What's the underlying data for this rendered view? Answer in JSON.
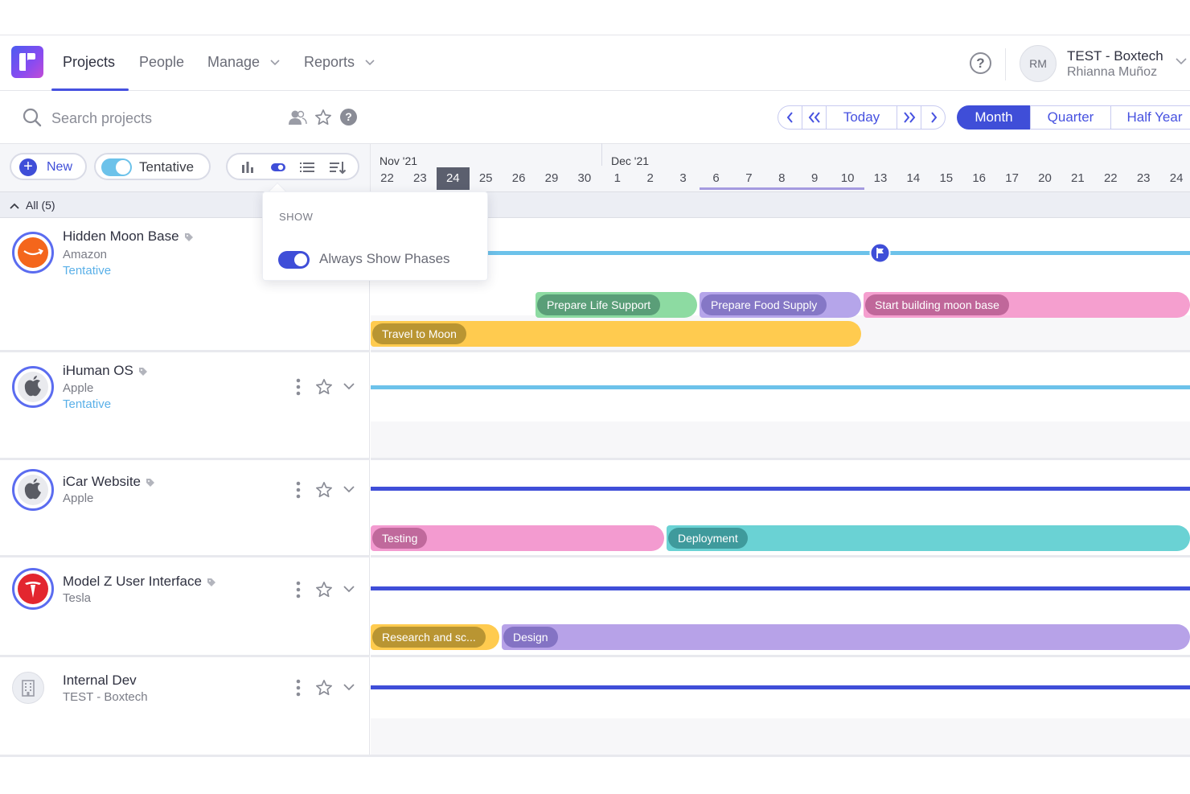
{
  "nav": {
    "items": [
      {
        "label": "Projects",
        "active": true
      },
      {
        "label": "People"
      },
      {
        "label": "Manage"
      },
      {
        "label": "Reports"
      }
    ],
    "help_label": "?",
    "account": {
      "avatar_initials": "RM",
      "name": "TEST - Boxtech",
      "user": "Rhianna Muñoz"
    }
  },
  "toolbar": {
    "search_placeholder": "Search projects",
    "help_label": "?",
    "date_nav": {
      "today": "Today"
    },
    "ranges": [
      {
        "label": "Month",
        "active": true
      },
      {
        "label": "Quarter"
      },
      {
        "label": "Half Year"
      }
    ],
    "new_label": "New",
    "new_plus": "+",
    "tentative_label": "Tentative",
    "tentative_on": true
  },
  "timeline": {
    "months": [
      {
        "label": "Nov '21"
      },
      {
        "label": "Dec '21"
      }
    ],
    "days": [
      "22",
      "23",
      "24",
      "25",
      "26",
      "29",
      "30",
      "1",
      "2",
      "3",
      "6",
      "7",
      "8",
      "9",
      "10",
      "13",
      "14",
      "15",
      "16",
      "17",
      "20",
      "21",
      "22",
      "23",
      "24"
    ],
    "today_index": 2
  },
  "group": {
    "label": "All (5)"
  },
  "popover": {
    "heading": "SHOW",
    "option_label": "Always Show Phases",
    "option_on": true
  },
  "projects": [
    {
      "title": "Hidden Moon Base",
      "client": "Amazon",
      "status": "Tentative",
      "logo": "amazon-logo",
      "track_color": "#6cc2ea",
      "phases": [
        {
          "label": "Prepare Life Support",
          "color": "#8ddba2",
          "pill": "#5a9e78"
        },
        {
          "label": "Prepare Food Supply",
          "color": "#b5a5ea",
          "pill": "#8577c6"
        },
        {
          "label": "Start building moon base",
          "color": "#f59fcf",
          "pill": "#c0679a"
        },
        {
          "label": "Travel to Moon",
          "color": "#ffcb4f",
          "pill": "#b99532"
        }
      ]
    },
    {
      "title": "iHuman OS",
      "client": "Apple",
      "status": "Tentative",
      "logo": "apple-logo",
      "track_color": "#6cc2ea",
      "phases": []
    },
    {
      "title": "iCar Website",
      "client": "Apple",
      "status": "",
      "logo": "apple-logo",
      "track_color": "#3f4ed8",
      "phases": [
        {
          "label": "Testing",
          "color": "#f39bd0",
          "pill": "#c0699c"
        },
        {
          "label": "Deployment",
          "color": "#6ad2d4",
          "pill": "#3f9a9c"
        }
      ]
    },
    {
      "title": "Model Z User Interface",
      "client": "Tesla",
      "status": "",
      "logo": "tesla-logo",
      "track_color": "#3f4ed8",
      "phases": [
        {
          "label": "Research and sc...",
          "color": "#ffcb4f",
          "pill": "#b99532"
        },
        {
          "label": "Design",
          "color": "#b7a2e8",
          "pill": "#8473c4"
        }
      ]
    },
    {
      "title": "Internal Dev",
      "client": "TEST - Boxtech",
      "status": "",
      "logo": "building-logo",
      "track_color": "#3f4ed8",
      "phases": []
    }
  ]
}
